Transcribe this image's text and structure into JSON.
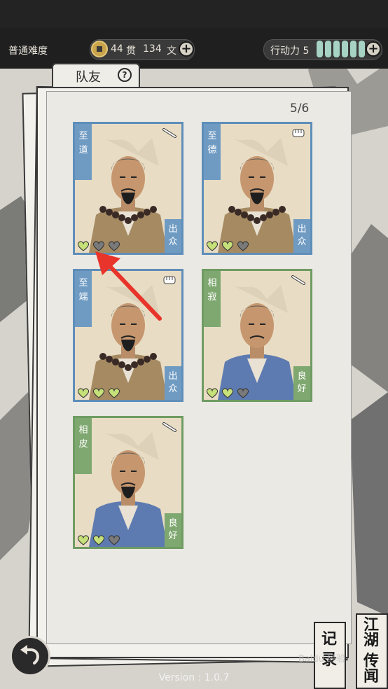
{
  "top_bar": {
    "difficulty": "普通难度",
    "guan_count": "44",
    "guan_label": "贯",
    "wen_count": "134",
    "wen_label": "文",
    "action_points_label": "行动力 5",
    "action_points": 5
  },
  "panel": {
    "tab_label": "队友",
    "help_icon": "?",
    "team_count": "5/6"
  },
  "cards": [
    {
      "name": "至\n道",
      "quality": "出\n众",
      "theme": "blue",
      "hearts_filled": 1,
      "hearts_total": 3,
      "icon": "sword-icon"
    },
    {
      "name": "至\n德",
      "quality": "出\n众",
      "theme": "blue",
      "hearts_filled": 2,
      "hearts_total": 3,
      "icon": "fist-icon"
    },
    {
      "name": "至\n端",
      "quality": "出\n众",
      "theme": "blue",
      "hearts_filled": 3,
      "hearts_total": 3,
      "icon": "fist-icon"
    },
    {
      "name": "相\n寂",
      "quality": "良\n好",
      "theme": "green",
      "hearts_filled": 2,
      "hearts_total": 3,
      "icon": "sword-icon"
    },
    {
      "name": "相\n皮",
      "quality": "良\n好",
      "theme": "green",
      "hearts_filled": 2,
      "hearts_total": 3,
      "icon": "sword-icon"
    }
  ],
  "bottom": {
    "version": "Version : 1.0.7",
    "journal_label": "记\n录",
    "rumors_label": "江湖\n传闻",
    "watermark": "Baidu 经验"
  },
  "colors": {
    "blue_frame": "#5e8eb9",
    "green_frame": "#6f9c62",
    "heart_filled": "#c6e07a",
    "heart_empty": "#7a7a7a",
    "arrow": "#e8342a",
    "action_bar": "#a6d3c3"
  }
}
